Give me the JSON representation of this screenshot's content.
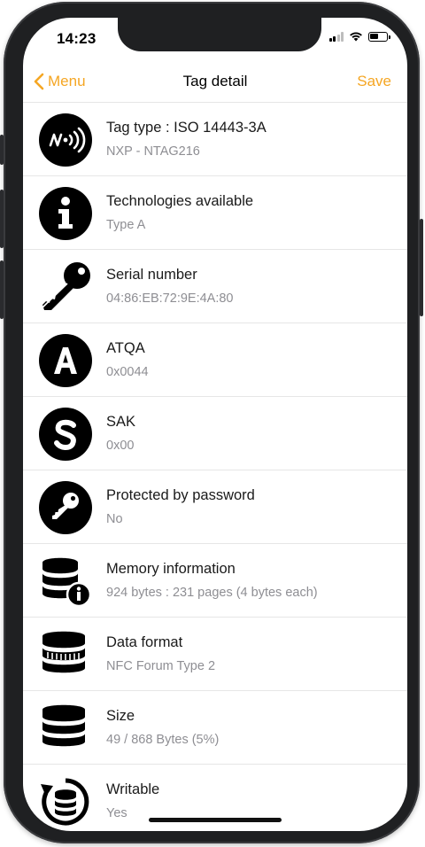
{
  "status_bar": {
    "time": "14:23",
    "icons": [
      "cellular-signal-icon",
      "wifi-icon",
      "battery-icon"
    ]
  },
  "nav": {
    "back_label": "Menu",
    "title": "Tag detail",
    "save_label": "Save"
  },
  "colors": {
    "accent": "#f5a623",
    "icon_fill": "#000000",
    "title_text": "#1a1a1a",
    "value_text": "#8e8e93"
  },
  "rows": [
    {
      "icon": "nfc-icon",
      "title": "Tag type : ISO 14443-3A",
      "value": "NXP - NTAG216"
    },
    {
      "icon": "info-icon",
      "title": "Technologies available",
      "value": "Type A"
    },
    {
      "icon": "key-icon",
      "title": "Serial number",
      "value": "04:86:EB:72:9E:4A:80"
    },
    {
      "icon": "letter-a-icon",
      "title": "ATQA",
      "value": "0x0044"
    },
    {
      "icon": "letter-s-icon",
      "title": "SAK",
      "value": "0x00"
    },
    {
      "icon": "password-key-icon",
      "title": "Protected by password",
      "value": "No"
    },
    {
      "icon": "database-info-icon",
      "title": "Memory information",
      "value": "924 bytes : 231 pages (4 bytes each)"
    },
    {
      "icon": "database-format-icon",
      "title": "Data format",
      "value": "NFC Forum Type 2"
    },
    {
      "icon": "database-icon",
      "title": "Size",
      "value": "49 / 868 Bytes (5%)"
    },
    {
      "icon": "database-refresh-icon",
      "title": "Writable",
      "value": "Yes"
    }
  ]
}
